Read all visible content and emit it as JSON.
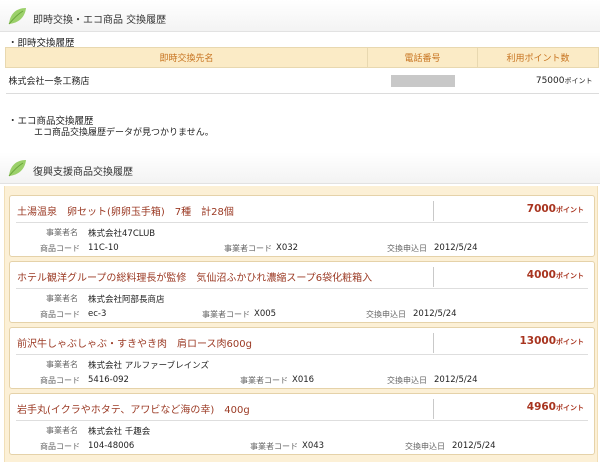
{
  "header1": {
    "title": "即時交換・エコ商品 交換履歴",
    "icon": "leaf-icon"
  },
  "instant": {
    "label": "・即時交換履歴",
    "columns": [
      "即時交換先名",
      "電話番号",
      "利用ポイント数"
    ],
    "rows": [
      {
        "name": "株式会社一条工務店",
        "points": "75000",
        "unit": "ポイント"
      }
    ]
  },
  "eco": {
    "label": "・エコ商品交換履歴",
    "empty_message": "エコ商品交換履歴データが見つかりません。"
  },
  "header2": {
    "title": "復興支援商品交換履歴",
    "icon": "leaf-icon"
  },
  "labels": {
    "vendor": "事業者名",
    "product_code": "商品コード",
    "vendor_code": "事業者コード",
    "apply_date": "交換申込日",
    "unit": "ポイント"
  },
  "items": [
    {
      "name": "土湯温泉　卵セット(卵卵玉手箱)　7種　計28個",
      "points": "7000",
      "vendor": "株式会社47CLUB",
      "product_code": "11C-10",
      "vendor_code": "X032",
      "date": "2012/5/24"
    },
    {
      "name": "ホテル観洋グループの総料理長が監修　気仙沼ふかひれ濃縮スープ6袋化粧箱入",
      "points": "4000",
      "vendor": "株式会社阿部長商店",
      "product_code": "ec-3",
      "vendor_code": "X005",
      "date": "2012/5/24"
    },
    {
      "name": "前沢牛しゃぶしゃぶ・すきやき肉　肩ロース肉600g",
      "points": "13000",
      "vendor": "株式会社 アルファーブレインズ",
      "product_code": "5416-092",
      "vendor_code": "X016",
      "date": "2012/5/24"
    },
    {
      "name": "岩手丸(イクラやホタテ、アワビなど海の幸)　400g",
      "points": "4960",
      "vendor": "株式会社 千趣会",
      "product_code": "104-48006",
      "vendor_code": "X043",
      "date": "2012/5/24"
    }
  ],
  "colors": {
    "accent": "#a8341f",
    "header_bg": "#fbebc6",
    "area_bg": "#fcf0d6"
  }
}
